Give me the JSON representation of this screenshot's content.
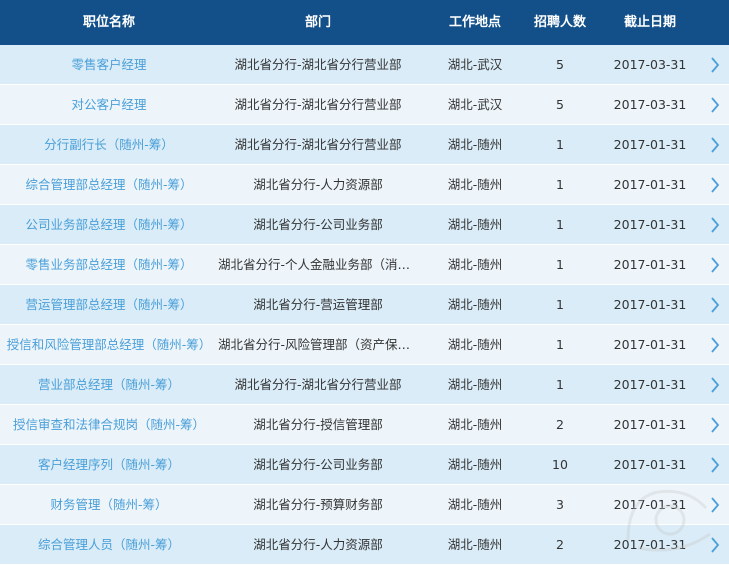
{
  "table": {
    "headers": {
      "title": "职位名称",
      "dept": "部门",
      "location": "工作地点",
      "count": "招聘人数",
      "deadline": "截止日期"
    },
    "rows": [
      {
        "title": "零售客户经理",
        "dept": "湖北省分行-湖北省分行营业部",
        "location": "湖北-武汉",
        "count": "5",
        "deadline": "2017-03-31"
      },
      {
        "title": "对公客户经理",
        "dept": "湖北省分行-湖北省分行营业部",
        "location": "湖北-武汉",
        "count": "5",
        "deadline": "2017-03-31"
      },
      {
        "title": "分行副行长（随州-筹）",
        "dept": "湖北省分行-湖北省分行营业部",
        "location": "湖北-随州",
        "count": "1",
        "deadline": "2017-01-31"
      },
      {
        "title": "综合管理部总经理（随州-筹）",
        "dept": "湖北省分行-人力资源部",
        "location": "湖北-随州",
        "count": "1",
        "deadline": "2017-01-31"
      },
      {
        "title": "公司业务部总经理（随州-筹）",
        "dept": "湖北省分行-公司业务部",
        "location": "湖北-随州",
        "count": "1",
        "deadline": "2017-01-31"
      },
      {
        "title": "零售业务部总经理（随州-筹）",
        "dept": "湖北省分行-个人金融业务部（消费...",
        "location": "湖北-随州",
        "count": "1",
        "deadline": "2017-01-31"
      },
      {
        "title": "营运管理部总经理（随州-筹）",
        "dept": "湖北省分行-营运管理部",
        "location": "湖北-随州",
        "count": "1",
        "deadline": "2017-01-31"
      },
      {
        "title": "授信和风险管理部总经理（随州-筹）",
        "dept": "湖北省分行-风险管理部（资产保全...",
        "location": "湖北-随州",
        "count": "1",
        "deadline": "2017-01-31"
      },
      {
        "title": "营业部总经理（随州-筹）",
        "dept": "湖北省分行-湖北省分行营业部",
        "location": "湖北-随州",
        "count": "1",
        "deadline": "2017-01-31"
      },
      {
        "title": "授信审查和法律合规岗（随州-筹）",
        "dept": "湖北省分行-授信管理部",
        "location": "湖北-随州",
        "count": "2",
        "deadline": "2017-01-31"
      },
      {
        "title": "客户经理序列（随州-筹）",
        "dept": "湖北省分行-公司业务部",
        "location": "湖北-随州",
        "count": "10",
        "deadline": "2017-01-31"
      },
      {
        "title": "财务管理（随州-筹）",
        "dept": "湖北省分行-预算财务部",
        "location": "湖北-随州",
        "count": "3",
        "deadline": "2017-01-31"
      },
      {
        "title": "综合管理人员（随州-筹）",
        "dept": "湖北省分行-人力资源部",
        "location": "湖北-随州",
        "count": "2",
        "deadline": "2017-01-31"
      }
    ]
  },
  "colors": {
    "header_bg": "#135089",
    "row_odd": "#d9ecf8",
    "row_even": "#edf5fb",
    "link_text": "#4a9fd8",
    "arrow": "#4a9fd8"
  },
  "icons": {
    "row_arrow": "chevron-right-icon"
  }
}
